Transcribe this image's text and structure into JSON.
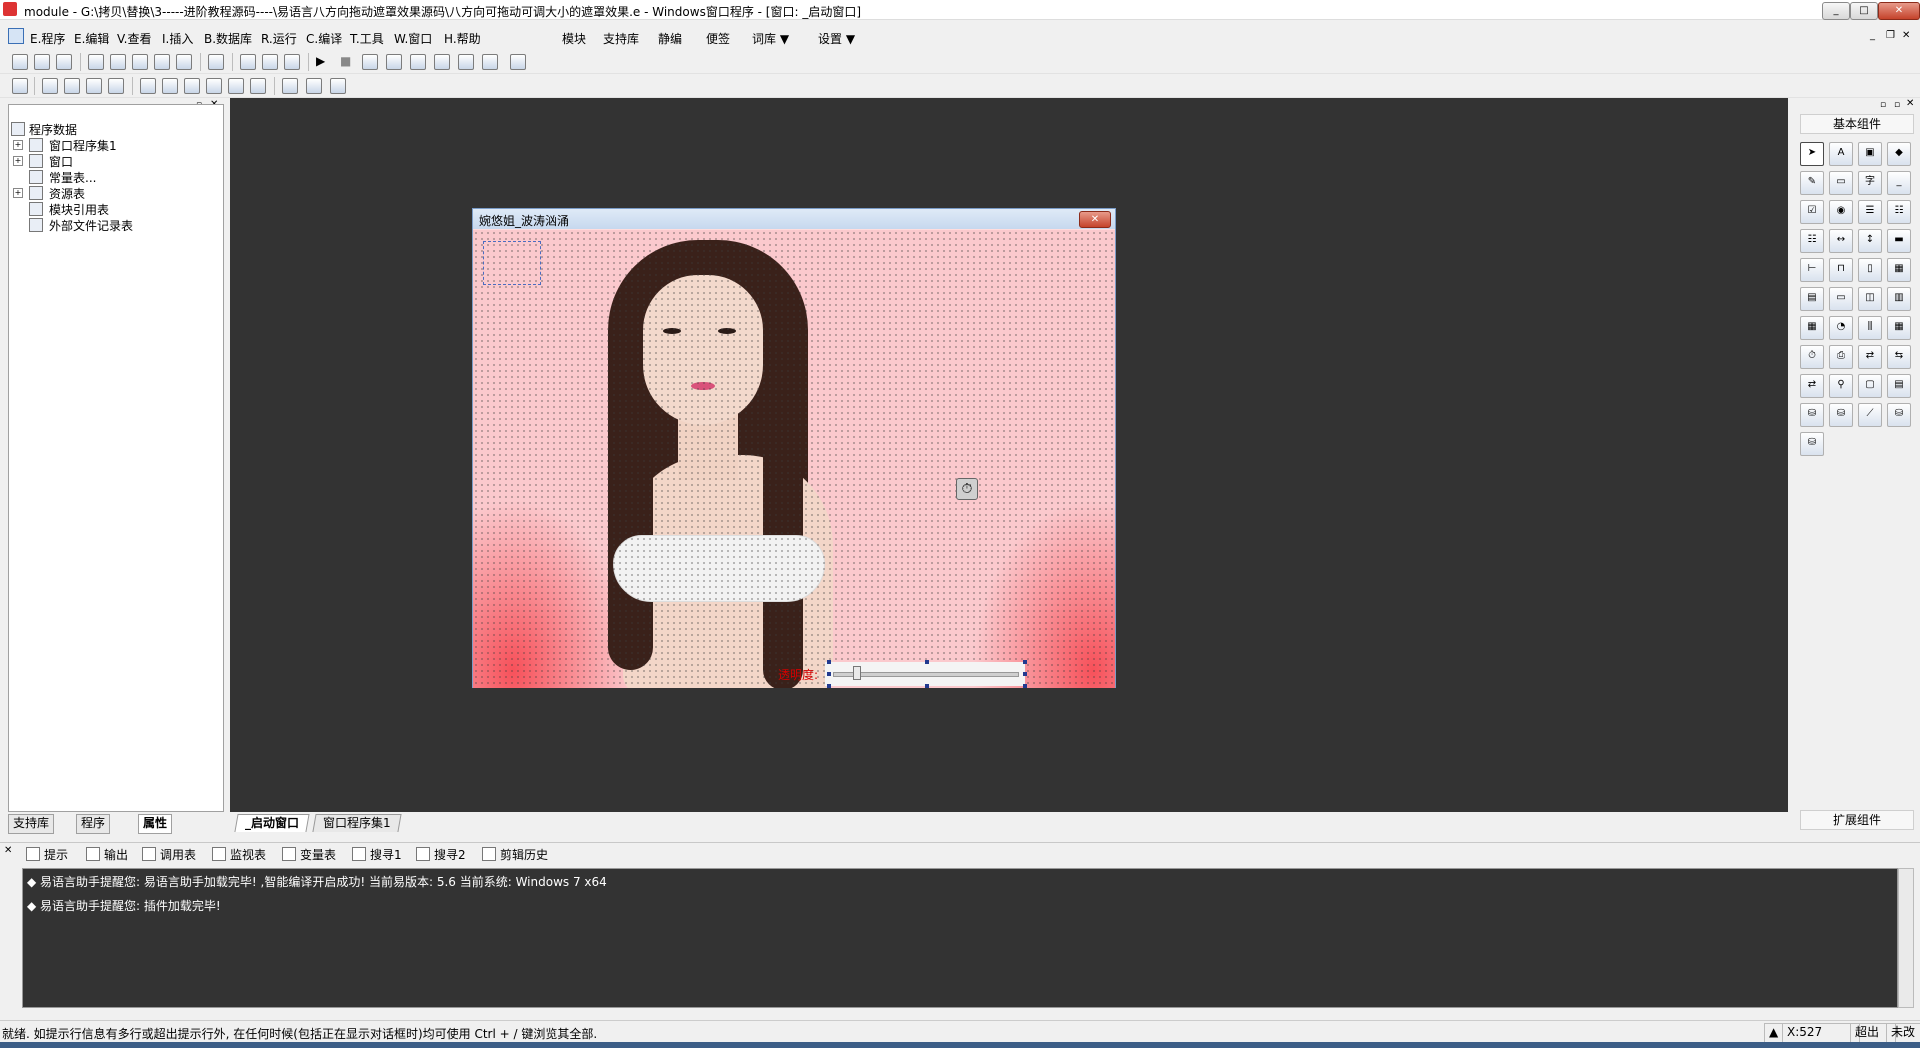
{
  "window": {
    "title": "module - G:\\拷贝\\替换\\3-----进阶教程源码----\\易语言八方向拖动遮罩效果源码\\八方向可拖动可调大小的遮罩效果.e - Windows窗口程序 - [窗口: _启动窗口]",
    "min": "_",
    "max": "□",
    "close": "✕"
  },
  "menu": {
    "items": [
      "E.程序",
      "E.编辑",
      "V.查看",
      "I.插入",
      "B.数据库",
      "R.运行",
      "C.编译",
      "T.工具",
      "W.窗口",
      "H.帮助"
    ],
    "extra": [
      "模块",
      "支持库",
      "静编",
      "便签",
      "词库 ▼",
      "设置 ▼"
    ]
  },
  "tree": {
    "root": "程序数据",
    "items": [
      "窗口程序集1",
      "窗口",
      "常量表...",
      "资源表",
      "模块引用表",
      "外部文件记录表"
    ]
  },
  "left_tabs": [
    "支持库",
    "程序",
    "属性"
  ],
  "form": {
    "title": "婉悠姐_波涛汹涌",
    "close": "✕",
    "opacity_label": "透明度:"
  },
  "right_panel": {
    "header": "基本组件",
    "footer": "扩展组件"
  },
  "editor_tabs": [
    "_启动窗口",
    "窗口程序集1"
  ],
  "output_tabs": [
    "提示",
    "输出",
    "调用表",
    "监视表",
    "变量表",
    "搜寻1",
    "搜寻2",
    "剪辑历史"
  ],
  "output_lines": [
    "◆ 易语言助手提醒您: 易语言助手加载完毕! ,智能编译开启成功! 当前易版本: 5.6 当前系统: Windows 7 x64",
    "◆ 易语言助手提醒您: 插件加载完毕!"
  ],
  "status": {
    "text": "就绪. 如提示行信息有多行或超出提示行外, 在任何时候(包括正在显示对话框时)均可使用 Ctrl + / 键浏览其全部.",
    "coord": "X:527",
    "overwrite": "超出",
    "modified": "未改"
  },
  "colors": {
    "workspace": "#333333",
    "form_bg": "#fbc9cd",
    "accent_red": "#d40000"
  }
}
